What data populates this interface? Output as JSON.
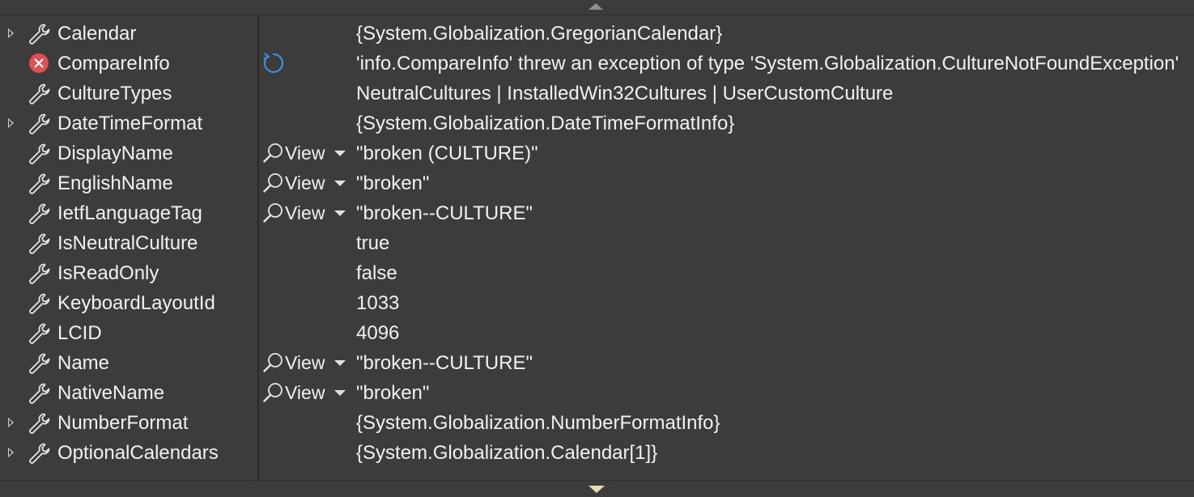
{
  "scroll": {
    "up_icon": "chevron-up-icon",
    "down_icon": "chevron-down-icon"
  },
  "colors": {
    "background": "#3c3c3c",
    "text": "#f1f1f1",
    "error_red": "#e04f52",
    "refresh_blue": "#3b8fd9"
  },
  "view_label": "View",
  "rows": [
    {
      "name": "Calendar",
      "value": "{System.Globalization.GregorianCalendar}",
      "expandable": true,
      "icon": "wrench-icon",
      "has_view": false
    },
    {
      "name": "CompareInfo",
      "value": "'info.CompareInfo' threw an exception of type 'System.Globalization.CultureNotFoundException'",
      "expandable": false,
      "icon": "error-icon",
      "has_view": false,
      "has_refresh": true
    },
    {
      "name": "CultureTypes",
      "value": "NeutralCultures | InstalledWin32Cultures | UserCustomCulture",
      "expandable": false,
      "icon": "wrench-icon",
      "has_view": false
    },
    {
      "name": "DateTimeFormat",
      "value": "{System.Globalization.DateTimeFormatInfo}",
      "expandable": true,
      "icon": "wrench-icon",
      "has_view": false
    },
    {
      "name": "DisplayName",
      "value": "\"broken (CULTURE)\"",
      "expandable": false,
      "icon": "wrench-icon",
      "has_view": true
    },
    {
      "name": "EnglishName",
      "value": "\"broken\"",
      "expandable": false,
      "icon": "wrench-icon",
      "has_view": true
    },
    {
      "name": "IetfLanguageTag",
      "value": "\"broken--CULTURE\"",
      "expandable": false,
      "icon": "wrench-icon",
      "has_view": true
    },
    {
      "name": "IsNeutralCulture",
      "value": "true",
      "expandable": false,
      "icon": "wrench-icon",
      "has_view": false
    },
    {
      "name": "IsReadOnly",
      "value": "false",
      "expandable": false,
      "icon": "wrench-icon",
      "has_view": false
    },
    {
      "name": "KeyboardLayoutId",
      "value": "1033",
      "expandable": false,
      "icon": "wrench-icon",
      "has_view": false
    },
    {
      "name": "LCID",
      "value": "4096",
      "expandable": false,
      "icon": "wrench-icon",
      "has_view": false
    },
    {
      "name": "Name",
      "value": "\"broken--CULTURE\"",
      "expandable": false,
      "icon": "wrench-icon",
      "has_view": true
    },
    {
      "name": "NativeName",
      "value": "\"broken\"",
      "expandable": false,
      "icon": "wrench-icon",
      "has_view": true
    },
    {
      "name": "NumberFormat",
      "value": "{System.Globalization.NumberFormatInfo}",
      "expandable": true,
      "icon": "wrench-icon",
      "has_view": false
    },
    {
      "name": "OptionalCalendars",
      "value": "{System.Globalization.Calendar[1]}",
      "expandable": true,
      "icon": "wrench-icon",
      "has_view": false
    }
  ]
}
